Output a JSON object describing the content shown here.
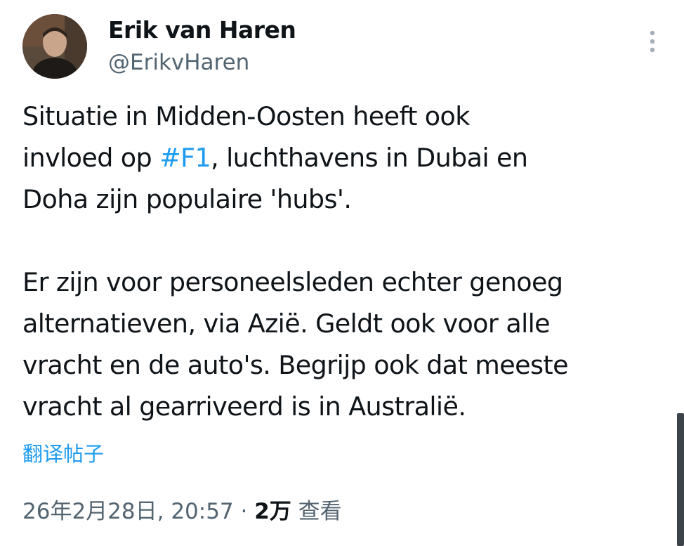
{
  "author": {
    "name": "Erik van Haren",
    "handle": "@ErikvHaren",
    "avatar_icon": "profile-photo"
  },
  "more_icon": "more-vertical-icon",
  "tweet": {
    "lines": [
      {
        "text": "Situatie in Midden-Oosten heeft ook"
      },
      {
        "before": "invloed op ",
        "hashtag": "#F1",
        "after": ", luchthavens in Dubai en"
      },
      {
        "text": "Doha zijn populaire 'hubs'."
      },
      {
        "text": ""
      },
      {
        "text": "Er zijn voor personeelsleden echter genoeg"
      },
      {
        "text": "alternatieven, via Azië. Geldt ook voor alle"
      },
      {
        "text": "vracht en de auto's. Begrijp ook dat meeste"
      },
      {
        "text": "vracht al gearriveerd is in Australië."
      }
    ]
  },
  "translate_label": "翻译帖子",
  "meta": {
    "timestamp": "26年2月28日, 20:57",
    "separator": " · ",
    "views_count": "2万",
    "views_label": " 查看"
  },
  "colors": {
    "link": "#1d9bf0",
    "text": "#0f1419",
    "secondary": "#536471",
    "scrollbar": "#3d4449"
  }
}
